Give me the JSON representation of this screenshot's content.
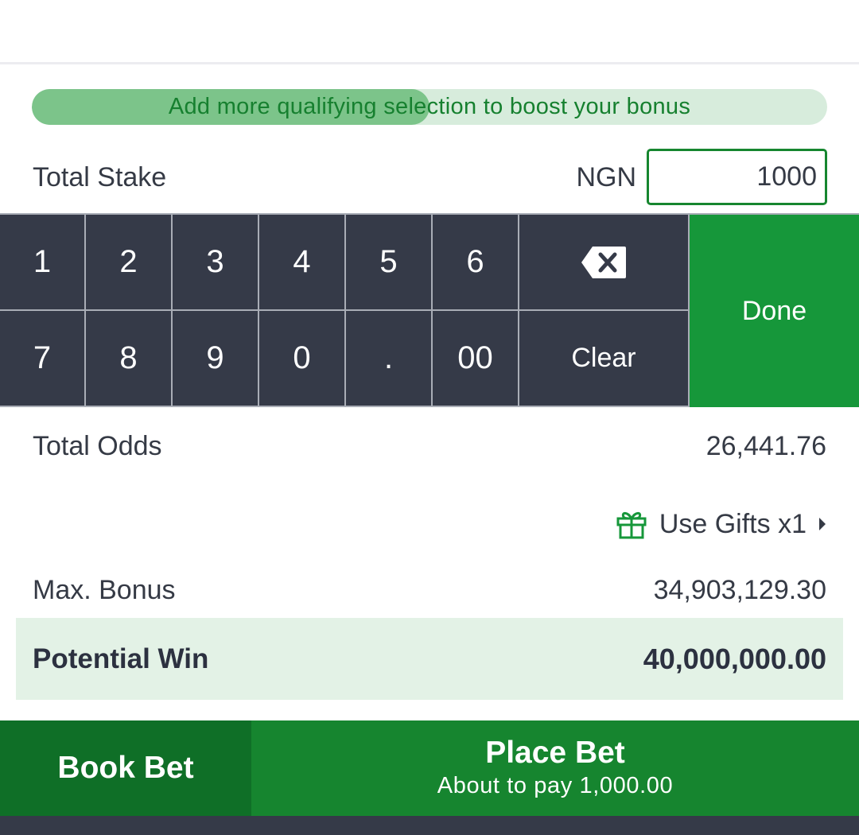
{
  "progress": {
    "message": "Add more qualifying selection to boost your bonus",
    "fraction": 0.5
  },
  "stake": {
    "label": "Total Stake",
    "currency": "NGN",
    "value": "1000"
  },
  "keypad": {
    "row1": [
      "1",
      "2",
      "3",
      "4",
      "5",
      "6"
    ],
    "row2": [
      "7",
      "8",
      "9",
      "0",
      ".",
      "00"
    ],
    "backspace_icon": "backspace-icon",
    "clear_label": "Clear",
    "done_label": "Done"
  },
  "summary": {
    "odds_label": "Total Odds",
    "odds_value": "26,441.76",
    "gifts_label": "Use Gifts x1",
    "gifts_icon": "gift-icon",
    "bonus_label": "Max. Bonus",
    "bonus_value": "34,903,129.30",
    "win_label": "Potential Win",
    "win_value": "40,000,000.00"
  },
  "actions": {
    "book_label": "Book Bet",
    "place_label": "Place Bet",
    "place_sub": "About to pay 1,000.00"
  },
  "colors": {
    "accent_green": "#16973a",
    "dark_green": "#0f6f27",
    "keypad_dark": "#353a48",
    "win_bg": "#e3f2e6"
  }
}
